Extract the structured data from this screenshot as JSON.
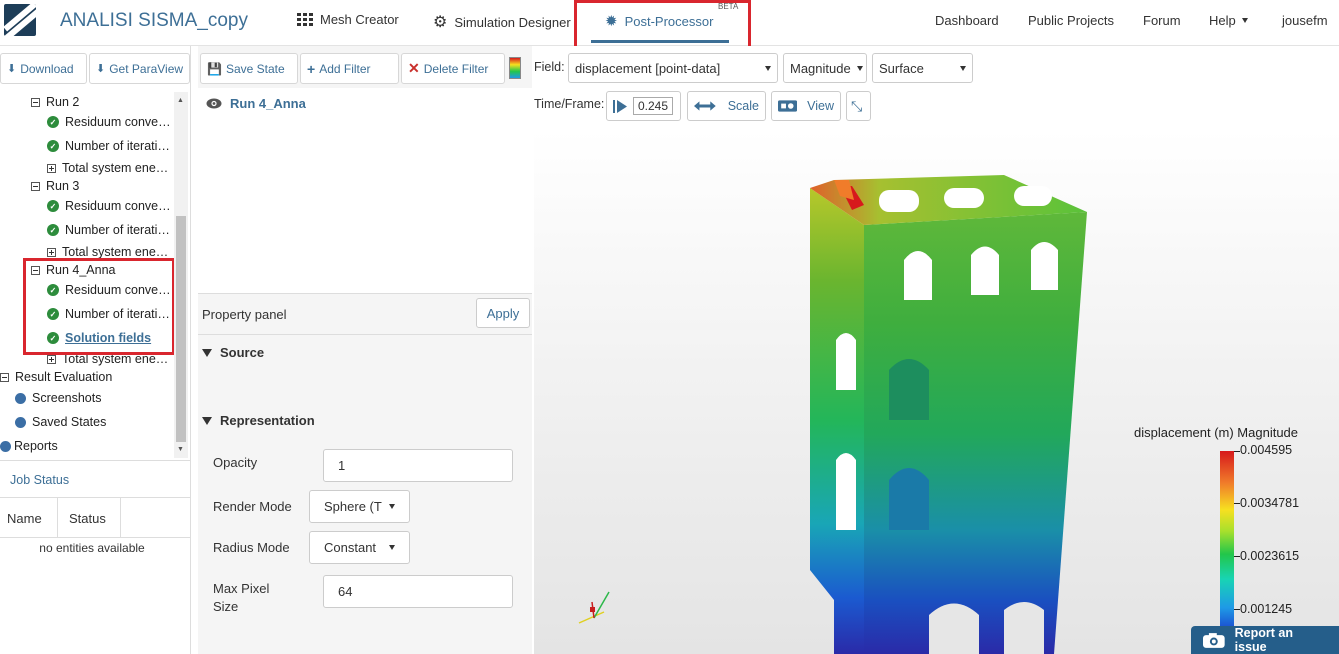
{
  "app": {
    "title": "ANALISI SISMA_copy"
  },
  "nav": {
    "mesh_creator": "Mesh Creator",
    "simulation_designer": "Simulation Designer",
    "post_processor": "Post-Processor",
    "beta": "BETA",
    "dashboard": "Dashboard",
    "public_projects": "Public Projects",
    "forum": "Forum",
    "help": "Help",
    "user": "jousefm"
  },
  "left": {
    "download": "Download",
    "get_paraview": "Get ParaView",
    "tree": {
      "run2": "Run 2",
      "run2_residuum": "Residuum conve…",
      "run2_iterations": "Number of iterati…",
      "run2_energy": "Total system ene…",
      "run3": "Run 3",
      "run3_residuum": "Residuum conve…",
      "run3_iterations": "Number of iterati…",
      "run3_energy": "Total system ene…",
      "run4": "Run 4_Anna",
      "run4_residuum": "Residuum conve…",
      "run4_iterations": "Number of iterati…",
      "run4_solution": "Solution fields",
      "run4_energy": "Total system ene…",
      "result_eval": "Result Evaluation",
      "screenshots": "Screenshots",
      "saved_states": "Saved States",
      "reports": "Reports"
    },
    "job_status": "Job Status",
    "col_name": "Name",
    "col_status": "Status",
    "no_entities": "no entities available"
  },
  "middle": {
    "save_state": "Save State",
    "add_filter": "Add Filter",
    "delete_filter": "Delete Filter",
    "pipeline_item": "Run 4_Anna",
    "property_panel": "Property panel",
    "apply": "Apply",
    "source": "Source",
    "representation": "Representation",
    "opacity_label": "Opacity",
    "opacity_value": "1",
    "render_mode_label": "Render Mode",
    "render_mode_value": "Sphere (T",
    "radius_mode_label": "Radius Mode",
    "radius_mode_value": "Constant",
    "max_pixel_label_1": "Max Pixel",
    "max_pixel_label_2": "Size",
    "max_pixel_value": "64"
  },
  "right": {
    "field_label": "Field:",
    "field_value": "displacement [point-data]",
    "component_value": "Magnitude",
    "repr_value": "Surface",
    "time_label": "Time/Frame:",
    "time_value": "0.245",
    "scale": "Scale",
    "view": "View",
    "legend_title": "displacement (m) Magnitude",
    "legend_values": [
      "0.004595",
      "0.0034781",
      "0.0023615",
      "0.001245"
    ],
    "report_issue": "Report an issue"
  },
  "colors": {
    "accent": "#3d6f96",
    "highlight_box": "#d9262e",
    "report_bg": "#255e8a",
    "check_green": "#2d8c3c"
  },
  "icons": [
    "grid-icon",
    "gears-icon",
    "gear-icon",
    "download-icon",
    "save-icon",
    "plus-icon",
    "close-icon",
    "eye-icon",
    "play-icon",
    "scale-arrows-icon",
    "camera-icon",
    "reset-view-icon",
    "report-camera-icon"
  ]
}
